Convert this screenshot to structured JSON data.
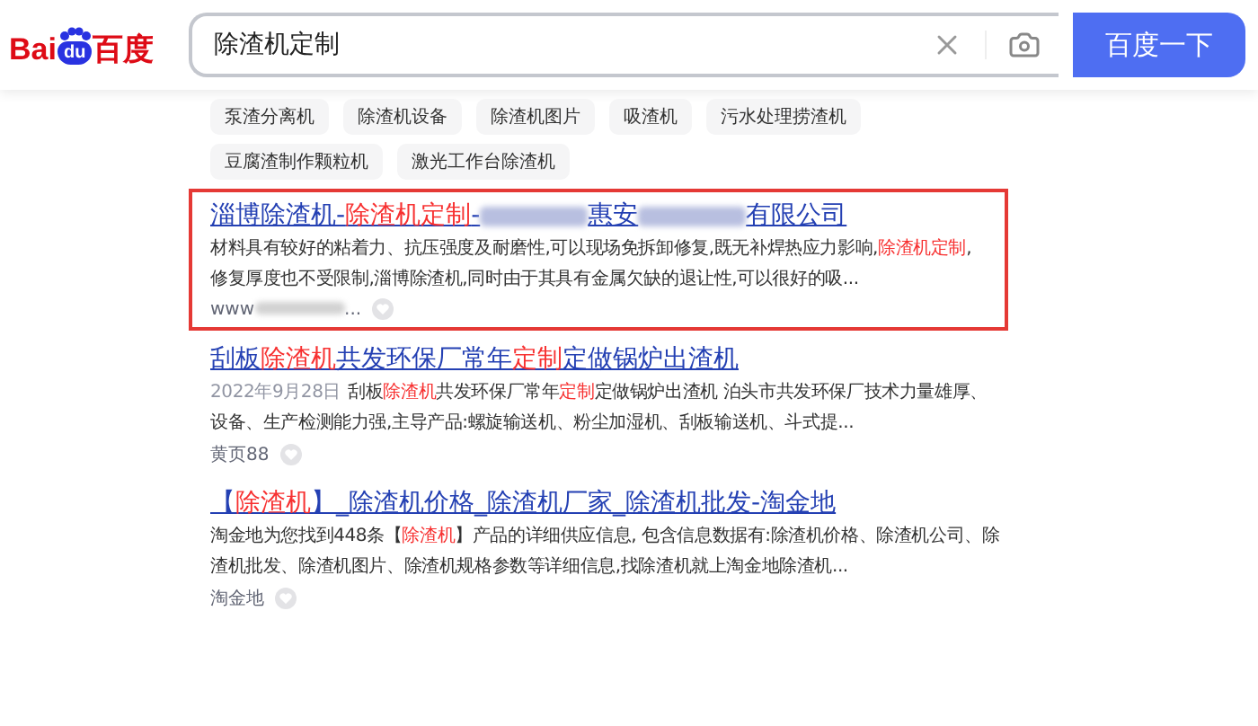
{
  "logo": {
    "left": "Bai",
    "paw": "du",
    "right": "百度"
  },
  "search": {
    "value": "除渣机定制",
    "button": "百度一下"
  },
  "related_tags": [
    [
      "泵渣分离机",
      "除渣机设备",
      "除渣机图片",
      "吸渣机",
      "污水处理捞渣机"
    ],
    [
      "豆腐渣制作颗粒机",
      "激光工作台除渣机"
    ]
  ],
  "results": [
    {
      "boxed": true,
      "title": [
        {
          "kind": "text",
          "text": "淄博除渣机-"
        },
        {
          "kind": "highlight",
          "text": "除渣机定制"
        },
        {
          "kind": "text",
          "text": "-"
        },
        {
          "kind": "redacted"
        },
        {
          "kind": "text",
          "text": "惠安"
        },
        {
          "kind": "redacted"
        },
        {
          "kind": "text",
          "text": "有限公司"
        }
      ],
      "snippet": [
        {
          "kind": "text",
          "text": "材料具有较好的粘着力、抗压强度及耐磨性,可以现场免拆卸修复,既无补焊热应力影响,"
        },
        {
          "kind": "highlight",
          "text": "除渣机定制"
        },
        {
          "kind": "text",
          "text": ",修复厚度也不受限制,淄博除渣机,同时由于其具有金属欠缺的退让性,可以很好的吸..."
        }
      ],
      "source": [
        {
          "kind": "text",
          "text": "www"
        },
        {
          "kind": "redacted"
        },
        {
          "kind": "text",
          "text": "..."
        }
      ]
    },
    {
      "boxed": false,
      "title": [
        {
          "kind": "text",
          "text": "刮板"
        },
        {
          "kind": "highlight",
          "text": "除渣机"
        },
        {
          "kind": "text",
          "text": "共发环保厂常年"
        },
        {
          "kind": "highlight",
          "text": "定制"
        },
        {
          "kind": "text",
          "text": "定做锅炉出渣机"
        }
      ],
      "date": "2022年9月28日",
      "snippet": [
        {
          "kind": "text",
          "text": "刮板"
        },
        {
          "kind": "highlight",
          "text": "除渣机"
        },
        {
          "kind": "text",
          "text": "共发环保厂常年"
        },
        {
          "kind": "highlight",
          "text": "定制"
        },
        {
          "kind": "text",
          "text": "定做锅炉出渣机 泊头市共发环保厂技术力量雄厚、设备、生产检测能力强,主导产品:螺旋输送机、粉尘加湿机、刮板输送机、斗式提..."
        }
      ],
      "source": [
        {
          "kind": "text",
          "text": "黄页88"
        }
      ]
    },
    {
      "boxed": false,
      "title": [
        {
          "kind": "text",
          "text": "【"
        },
        {
          "kind": "highlight",
          "text": "除渣机"
        },
        {
          "kind": "text",
          "text": "】_除渣机价格_除渣机厂家_除渣机批发-淘金地"
        }
      ],
      "snippet": [
        {
          "kind": "text",
          "text": "淘金地为您找到448条【"
        },
        {
          "kind": "highlight",
          "text": "除渣机"
        },
        {
          "kind": "text",
          "text": "】产品的详细供应信息, 包含信息数据有:除渣机价格、除渣机公司、除渣机批发、除渣机图片、除渣机规格参数等详细信息,找除渣机就上淘金地除渣机..."
        }
      ],
      "source": [
        {
          "kind": "text",
          "text": "淘金地"
        }
      ]
    }
  ]
}
